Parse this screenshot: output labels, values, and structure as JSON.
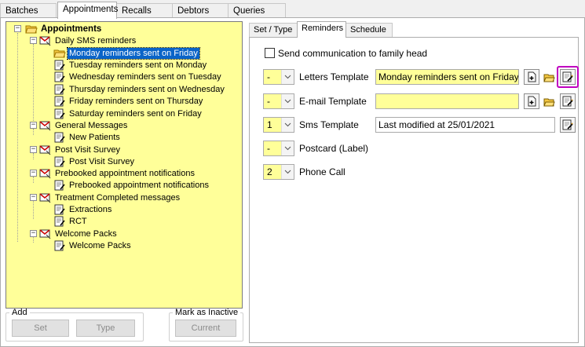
{
  "top_tabs": [
    {
      "label": "Batches"
    },
    {
      "label": "Appointments"
    },
    {
      "label": "Recalls"
    },
    {
      "label": "Debtors"
    },
    {
      "label": "Queries"
    }
  ],
  "tree": {
    "root": "Appointments",
    "groups": [
      {
        "label": "Daily SMS reminders",
        "items": [
          "Monday reminders sent on Friday",
          "Tuesday reminders sent on Monday",
          "Wednesday reminders sent on Tuesday",
          "Thursday reminders sent on Wednesday",
          "Friday reminders sent on Thursday",
          "Saturday reminders sent on Friday"
        ]
      },
      {
        "label": "General Messages",
        "items": [
          "New Patients"
        ]
      },
      {
        "label": "Post Visit Survey",
        "items": [
          "Post Visit Survey"
        ]
      },
      {
        "label": "Prebooked appointment notifications",
        "items": [
          "Prebooked appointment notifications"
        ]
      },
      {
        "label": "Treatment Completed messages",
        "items": [
          "Extractions",
          "RCT"
        ]
      },
      {
        "label": "Welcome Packs",
        "items": [
          "Welcome Packs"
        ]
      }
    ],
    "selected": "Monday reminders sent on Friday"
  },
  "add_group": {
    "legend": "Add",
    "set_label": "Set",
    "type_label": "Type"
  },
  "inactive_group": {
    "legend": "Mark as Inactive",
    "current_label": "Current"
  },
  "right_tabs": [
    {
      "label": "Set / Type"
    },
    {
      "label": "Reminders"
    },
    {
      "label": "Schedule"
    }
  ],
  "reminders": {
    "family_head_label": "Send communication to family head",
    "family_head_checked": false,
    "rows": {
      "letters": {
        "combo": "-",
        "label": "Letters Template",
        "value": "Monday reminders sent on Friday.rtf"
      },
      "email": {
        "combo": "-",
        "label": "E-mail Template",
        "value": ""
      },
      "sms": {
        "combo": "1",
        "label": "Sms Template",
        "value": "Last modified at 25/01/2021"
      },
      "postcard": {
        "combo": "-",
        "label": "Postcard (Label)"
      },
      "phone": {
        "combo": "2",
        "label": "Phone Call"
      }
    }
  },
  "icons": {
    "new": "new-document-icon",
    "open": "open-folder-icon",
    "edit": "edit-template-icon",
    "group": "message-group-icon",
    "item": "template-item-icon"
  },
  "colors": {
    "tree_bg": "#ffff99",
    "selection": "#0a64c8",
    "highlight": "#c000c0"
  }
}
